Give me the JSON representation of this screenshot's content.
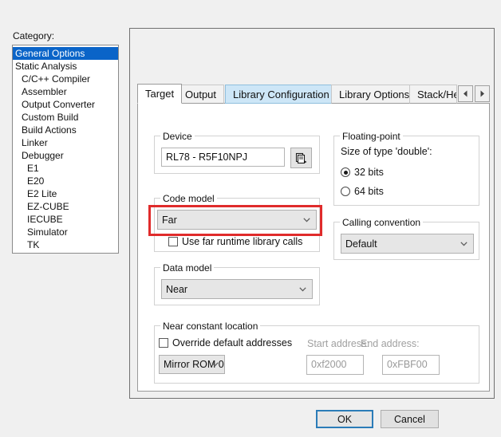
{
  "category": {
    "label": "Category:",
    "items": [
      {
        "label": "General Options",
        "indent": 0,
        "selected": true
      },
      {
        "label": "Static Analysis",
        "indent": 0,
        "selected": false
      },
      {
        "label": "C/C++ Compiler",
        "indent": 1,
        "selected": false
      },
      {
        "label": "Assembler",
        "indent": 1,
        "selected": false
      },
      {
        "label": "Output Converter",
        "indent": 1,
        "selected": false
      },
      {
        "label": "Custom Build",
        "indent": 1,
        "selected": false
      },
      {
        "label": "Build Actions",
        "indent": 1,
        "selected": false
      },
      {
        "label": "Linker",
        "indent": 1,
        "selected": false
      },
      {
        "label": "Debugger",
        "indent": 1,
        "selected": false
      },
      {
        "label": "E1",
        "indent": 2,
        "selected": false
      },
      {
        "label": "E20",
        "indent": 2,
        "selected": false
      },
      {
        "label": "E2 Lite",
        "indent": 2,
        "selected": false
      },
      {
        "label": "EZ-CUBE",
        "indent": 2,
        "selected": false
      },
      {
        "label": "IECUBE",
        "indent": 2,
        "selected": false
      },
      {
        "label": "Simulator",
        "indent": 2,
        "selected": false
      },
      {
        "label": "TK",
        "indent": 2,
        "selected": false
      }
    ]
  },
  "tabs": [
    {
      "label": "Target",
      "state": "active"
    },
    {
      "label": "Output",
      "state": "normal"
    },
    {
      "label": "Library Configuration",
      "state": "hover"
    },
    {
      "label": "Library Options",
      "state": "normal"
    },
    {
      "label": "Stack/Heap",
      "state": "clipped"
    }
  ],
  "tab_scroll": {
    "left_icon": "triangle-left-icon",
    "right_icon": "triangle-right-icon"
  },
  "target_tab": {
    "device_group": {
      "title": "Device",
      "value": "RL78 - R5F10NPJ",
      "picker_icon": "device-picker-icon"
    },
    "floating_point_group": {
      "title": "Floating-point",
      "size_label": "Size of type 'double':",
      "options": [
        {
          "label": "32 bits",
          "selected": true
        },
        {
          "label": "64 bits",
          "selected": false
        }
      ]
    },
    "code_model_group": {
      "title": "Code model",
      "value": "Far",
      "checkbox_label": "Use far runtime library calls",
      "checkbox_checked": false,
      "highlight_color": "#e02b2b"
    },
    "calling_convention_group": {
      "title": "Calling convention",
      "value": "Default"
    },
    "data_model_group": {
      "title": "Data model",
      "value": "Near"
    },
    "near_constant_group": {
      "title": "Near constant location",
      "override_label": "Override default addresses",
      "override_checked": false,
      "mirror_value": "Mirror ROM 0",
      "start_label": "Start address:",
      "start_value": "0xf2000",
      "end_label": "End address:",
      "end_value": "0xFBF00"
    }
  },
  "buttons": {
    "ok": "OK",
    "cancel": "Cancel"
  }
}
